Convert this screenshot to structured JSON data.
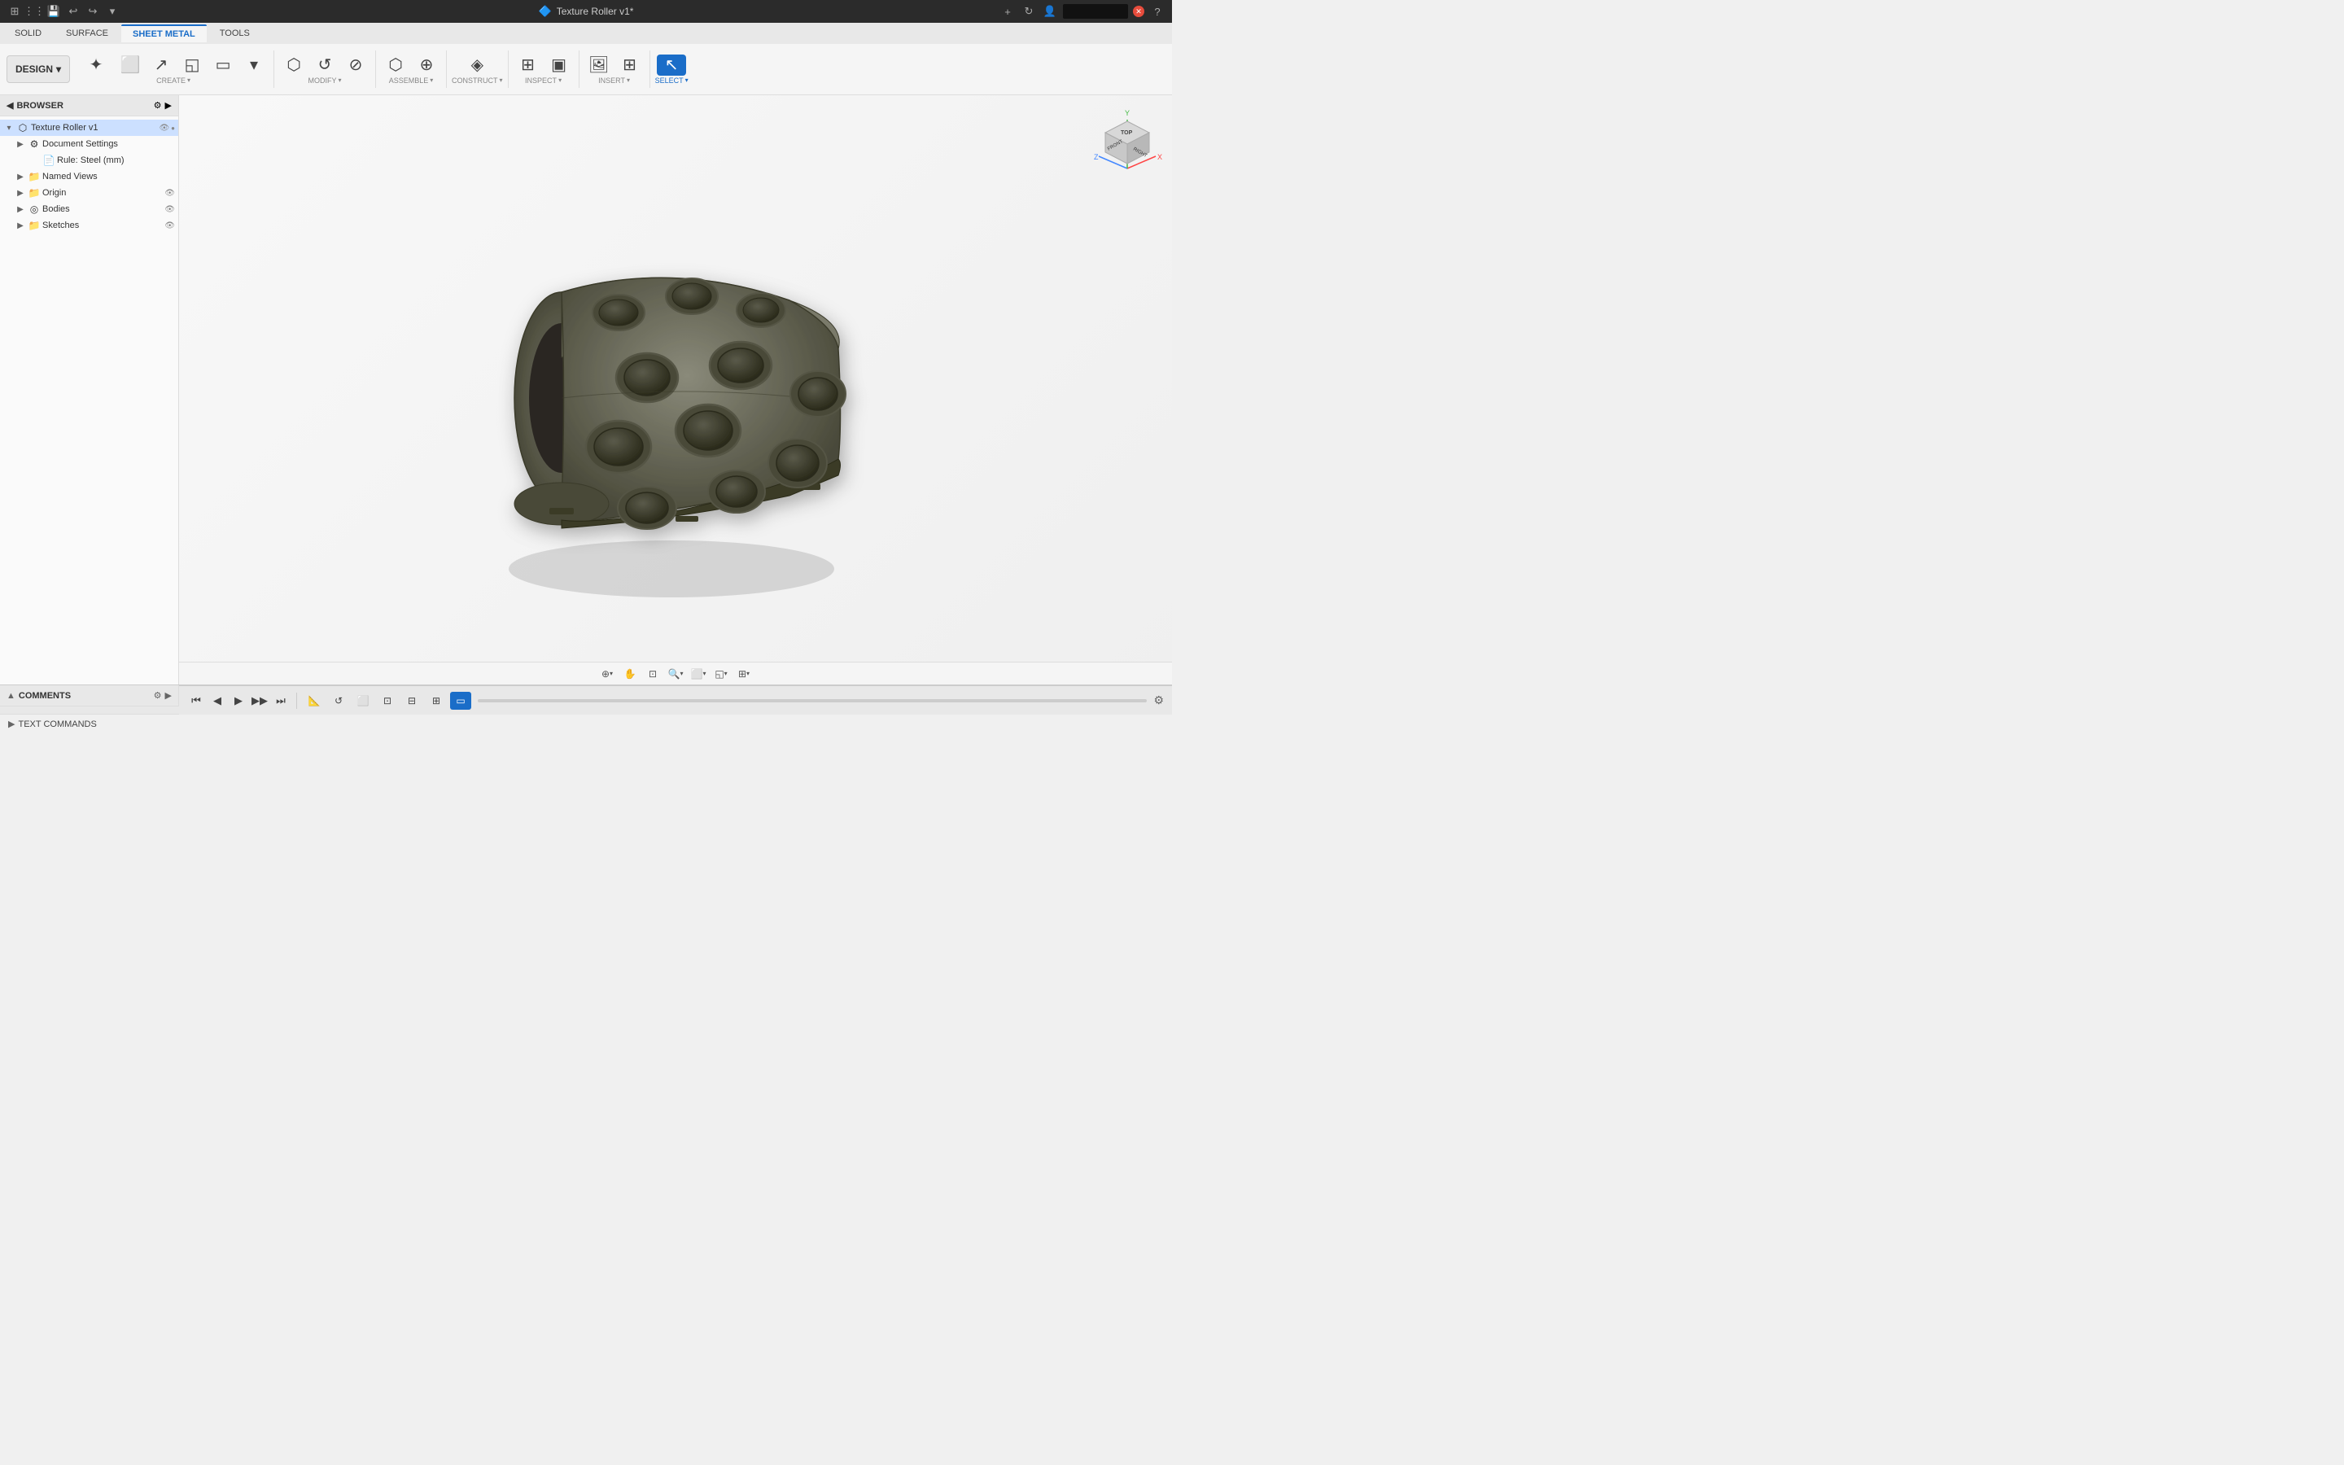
{
  "titlebar": {
    "app_name": "Texture Roller v1*",
    "close_icon": "✕",
    "add_icon": "+",
    "help_icon": "?",
    "settings_icon": "⚙"
  },
  "toolbar_tabs": [
    {
      "label": "SOLID",
      "active": false
    },
    {
      "label": "SURFACE",
      "active": false
    },
    {
      "label": "SHEET METAL",
      "active": true
    },
    {
      "label": "TOOLS",
      "active": false
    }
  ],
  "design_button": {
    "label": "DESIGN",
    "arrow": "▾"
  },
  "toolbar_sections": [
    {
      "id": "create",
      "label": "CREATE",
      "buttons": [
        {
          "icon": "✦",
          "label": ""
        },
        {
          "icon": "⬜",
          "label": ""
        },
        {
          "icon": "↗",
          "label": ""
        },
        {
          "icon": "◱",
          "label": ""
        },
        {
          "icon": "▭",
          "label": ""
        },
        {
          "icon": "◌",
          "label": ""
        },
        {
          "icon": "⌬",
          "label": ""
        }
      ]
    },
    {
      "id": "modify",
      "label": "MODIFY",
      "buttons": [
        {
          "icon": "⬡",
          "label": ""
        },
        {
          "icon": "↺",
          "label": ""
        },
        {
          "icon": "⊘",
          "label": ""
        }
      ]
    },
    {
      "id": "assemble",
      "label": "ASSEMBLE",
      "buttons": [
        {
          "icon": "⬡",
          "label": ""
        },
        {
          "icon": "⊕",
          "label": ""
        }
      ]
    },
    {
      "id": "construct",
      "label": "CONSTRUCT",
      "buttons": [
        {
          "icon": "◈",
          "label": ""
        }
      ]
    },
    {
      "id": "inspect",
      "label": "INSPECT",
      "buttons": [
        {
          "icon": "⊞",
          "label": ""
        },
        {
          "icon": "▣",
          "label": ""
        }
      ]
    },
    {
      "id": "insert",
      "label": "INSERT",
      "buttons": [
        {
          "icon": "🖼",
          "label": ""
        },
        {
          "icon": "⊞",
          "label": ""
        }
      ]
    },
    {
      "id": "select",
      "label": "SELECT",
      "active": true,
      "buttons": [
        {
          "icon": "↖",
          "label": "",
          "active": true
        }
      ]
    }
  ],
  "browser": {
    "title": "BROWSER",
    "items": [
      {
        "level": 0,
        "expander": "▾",
        "icon": "◈",
        "label": "Texture Roller v1",
        "has_eye": true,
        "has_dot": true,
        "selected": true
      },
      {
        "level": 1,
        "expander": "▶",
        "icon": "⚙",
        "label": "Document Settings",
        "has_eye": false
      },
      {
        "level": 2,
        "expander": "",
        "icon": "📄",
        "label": "Rule: Steel (mm)",
        "has_eye": false
      },
      {
        "level": 1,
        "expander": "▶",
        "icon": "📁",
        "label": "Named Views",
        "has_eye": false
      },
      {
        "level": 1,
        "expander": "▶",
        "icon": "📁",
        "label": "Origin",
        "has_eye": true
      },
      {
        "level": 1,
        "expander": "▶",
        "icon": "◎",
        "label": "Bodies",
        "has_eye": true
      },
      {
        "level": 1,
        "expander": "▶",
        "icon": "📁",
        "label": "Sketches",
        "has_eye": true
      }
    ]
  },
  "comments": {
    "title": "COMMENTS"
  },
  "bottom_viewport_tools": [
    {
      "icon": "⊕",
      "has_arrow": true
    },
    {
      "icon": "✋",
      "has_arrow": false
    },
    {
      "icon": "🔍",
      "has_arrow": false
    },
    {
      "icon": "🔍",
      "has_arrow": true,
      "label": "zoom"
    },
    {
      "icon": "⬜",
      "has_arrow": true
    },
    {
      "icon": "◱",
      "has_arrow": true
    },
    {
      "icon": "⊞",
      "has_arrow": true
    }
  ],
  "anim_controls": [
    {
      "icon": "⏮",
      "label": "go-start"
    },
    {
      "icon": "◀",
      "label": "prev"
    },
    {
      "icon": "▶",
      "label": "play"
    },
    {
      "icon": "▶▶",
      "label": "next"
    },
    {
      "icon": "⏭",
      "label": "go-end"
    }
  ],
  "anim_icons": [
    {
      "icon": "📐",
      "selected": false
    },
    {
      "icon": "↺",
      "selected": false
    },
    {
      "icon": "⬜",
      "selected": false
    },
    {
      "icon": "⊡",
      "selected": false
    },
    {
      "icon": "⊟",
      "selected": false
    },
    {
      "icon": "⊞",
      "selected": false
    },
    {
      "icon": "▭",
      "selected": true
    }
  ],
  "text_commands": {
    "label": "TEXT COMMANDS"
  }
}
